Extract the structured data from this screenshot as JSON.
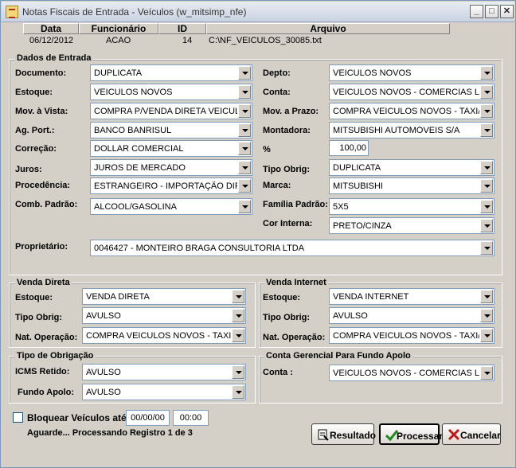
{
  "window": {
    "title": "Notas Fiscais de Entrada - Veículos (w_mitsimp_nfe)"
  },
  "grid": {
    "headers": [
      "Data",
      "Funcionário",
      "ID",
      "Arquivo"
    ],
    "row": [
      "06/12/2012",
      "ACAO",
      "14",
      "C:\\NF_VEICULOS_30085.txt"
    ]
  },
  "entrada": {
    "group_label": "Dados de Entrada",
    "documento": {
      "label": "Documento:",
      "value": "DUPLICATA"
    },
    "estoque": {
      "label": "Estoque:",
      "value": "VEICULOS NOVOS"
    },
    "mov_vista": {
      "label": "Mov. à Vista:",
      "value": "COMPRA P/VENDA DIRETA VEICULOS"
    },
    "ag_port": {
      "label": "Ag. Port.:",
      "value": "BANCO BANRISUL"
    },
    "correcao": {
      "label": "Correção:",
      "value": "DOLLAR COMERCIAL"
    },
    "juros": {
      "label": "Juros:",
      "value": "JUROS DE MERCADO"
    },
    "procedencia": {
      "label": "Procedência:",
      "value": "ESTRANGEIRO - IMPORTAÇÃO DIRETA"
    },
    "comb_padrao": {
      "label": "Comb. Padrão:",
      "value": "ALCOOL/GASOLINA"
    },
    "depto": {
      "label": "Depto:",
      "value": "VEICULOS NOVOS"
    },
    "conta": {
      "label": "Conta:",
      "value": "VEICULOS NOVOS - COMERCIAS LEVES"
    },
    "mov_prazo": {
      "label": "Mov. a Prazo:",
      "value": "COMPRA  VEICULOS NOVOS - TAXI/DEF"
    },
    "montadora": {
      "label": "Montadora:",
      "value": "MITSUBISHI AUTOMÓVEIS S/A"
    },
    "percent": {
      "label": "%",
      "value": "100,00"
    },
    "tipo_obrig": {
      "label": "Tipo Obrig:",
      "value": "DUPLICATA"
    },
    "marca": {
      "label": "Marca:",
      "value": "MITSUBISHI"
    },
    "familia": {
      "label": "Família Padrão:",
      "value": "5X5"
    },
    "cor_interna": {
      "label": "Cor Interna:",
      "value": "PRETO/CINZA"
    },
    "proprietario": {
      "label": "Proprietário:",
      "value": "0046427 - MONTEIRO BRAGA CONSULTORIA LTDA"
    }
  },
  "venda_direta": {
    "group_label": "Venda Direta",
    "estoque": {
      "label": "Estoque:",
      "value": "VENDA DIRETA"
    },
    "tipo_obrig": {
      "label": "Tipo Obrig:",
      "value": "AVULSO"
    },
    "nat_operacao": {
      "label": "Nat. Operação:",
      "value": "COMPRA  VEICULOS NOVOS - TAXI/DEF"
    }
  },
  "venda_internet": {
    "group_label": "Venda Internet",
    "estoque": {
      "label": "Estoque:",
      "value": "VENDA INTERNET"
    },
    "tipo_obrig": {
      "label": "Tipo Obrig:",
      "value": "AVULSO"
    },
    "nat_operacao": {
      "label": "Nat. Operação:",
      "value": "COMPRA  VEICULOS NOVOS - TAXI/DEF"
    }
  },
  "tipo_obrigacao": {
    "group_label": "Tipo de Obrigação",
    "icms": {
      "label": "ICMS Retido:",
      "value": "AVULSO"
    },
    "fundo": {
      "label": "Fundo Apolo:",
      "value": "AVULSO"
    }
  },
  "conta_gerencial": {
    "group_label": "Conta Gerencial Para Fundo Apolo",
    "conta": {
      "label": "Conta :",
      "value": "VEICULOS NOVOS - COMERCIAS LEVES"
    }
  },
  "bloquear": {
    "label": "Bloquear Veículos até:",
    "date": "00/00/00",
    "time": "00:00"
  },
  "status": "Aguarde... Processando Registro 1 de 3",
  "buttons": {
    "resultado": "Resultado",
    "processar": "Processar",
    "cancelar": "Cancelar"
  },
  "icons": {
    "app": "document-icon",
    "minimize": "minimize-icon",
    "maximize": "maximize-icon",
    "close": "close-icon"
  }
}
